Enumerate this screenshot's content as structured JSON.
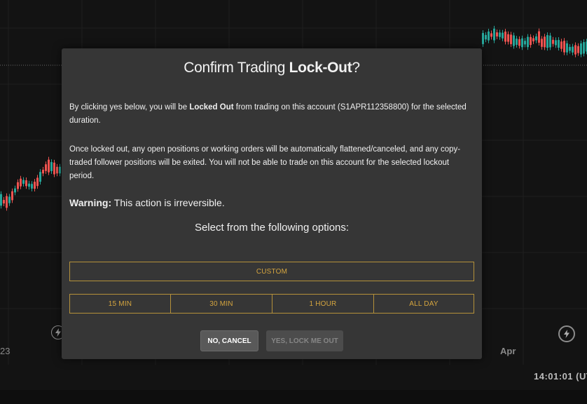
{
  "chart_background": {
    "axis_labels": {
      "left_date": "23",
      "right_date": "Apr"
    },
    "clock": "14:01:01 (UT",
    "colors": {
      "up": "#26a69a",
      "down": "#ef5350"
    }
  },
  "modal": {
    "title_prefix": "Confirm Trading ",
    "title_bold": "Lock-Out",
    "title_suffix": "?",
    "para1_prefix": "By clicking yes below, you will be ",
    "para1_bold": "Locked Out",
    "para1_suffix": " from trading on this account (S1APR112358800) for the selected duration.",
    "para2": "Once locked out, any open positions or working orders will be automatically flattened/canceled, and any copy-traded follower positions will be exited. You will not be able to trade on this account for the selected lockout period.",
    "warning_label": "Warning:",
    "warning_text": " This action is irreversible.",
    "select_label": "Select from the following options:",
    "custom_label": "CUSTOM",
    "duration_options": [
      "15 MIN",
      "30 MIN",
      "1 HOUR",
      "ALL DAY"
    ],
    "cancel_label": "NO, CANCEL",
    "confirm_label": "YES, LOCK ME OUT",
    "accent_color": "#d5a53f"
  }
}
